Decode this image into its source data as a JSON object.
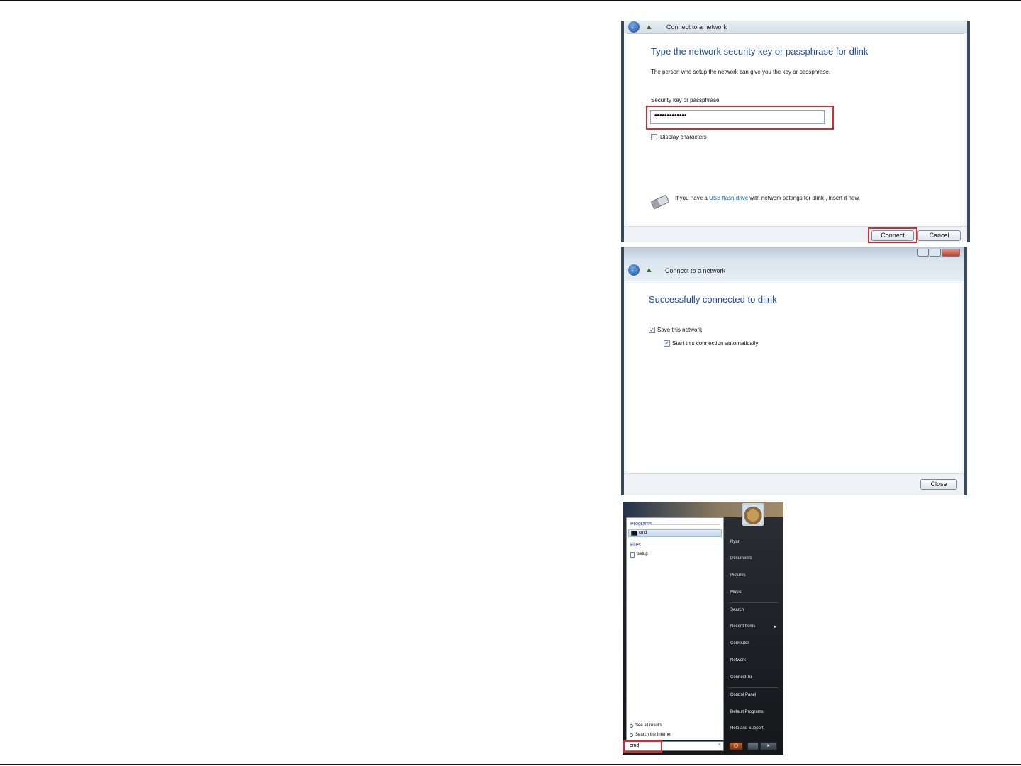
{
  "dialog_connect": {
    "title": "Connect to a network",
    "heading": "Type the network security key or passphrase for dlink",
    "instruction": "The person who setup the network can give you the key or passphrase.",
    "key_label": "Security key or passphrase:",
    "key_value": "•••••••••••••",
    "display_characters_label": "Display characters",
    "display_characters_checked": false,
    "usb_text_before": "If you have a ",
    "usb_link": "USB flash drive",
    "usb_text_after": " with network settings for dlink , insert it now.",
    "connect_button": "Connect",
    "cancel_button": "Cancel"
  },
  "dialog_success": {
    "title": "Connect to a network",
    "heading": "Successfully connected to dlink",
    "save_network_label": "Save this network",
    "save_network_checked": true,
    "auto_start_label": "Start this connection automatically",
    "auto_start_checked": true,
    "close_button": "Close"
  },
  "start_menu": {
    "programs_group": "Programs",
    "program_result": "cmd",
    "files_group": "Files",
    "file_result": "setup",
    "see_all_results": "See all results",
    "search_internet": "Search the Internet",
    "search_value": "cmd",
    "search_clear_icon": "×",
    "power_icon": "⏻",
    "arrow_icon": "▸",
    "right_items": [
      "Ryan",
      "Documents",
      "Pictures",
      "Music",
      "Search",
      "Recent Items",
      "Computer",
      "Network",
      "Connect To",
      "Control Panel",
      "Default Programs",
      "Help and Support"
    ]
  },
  "colors": {
    "highlight_red": "#d52b2b",
    "heading_blue": "#1f4fa0",
    "link_blue": "#1a55b5"
  }
}
